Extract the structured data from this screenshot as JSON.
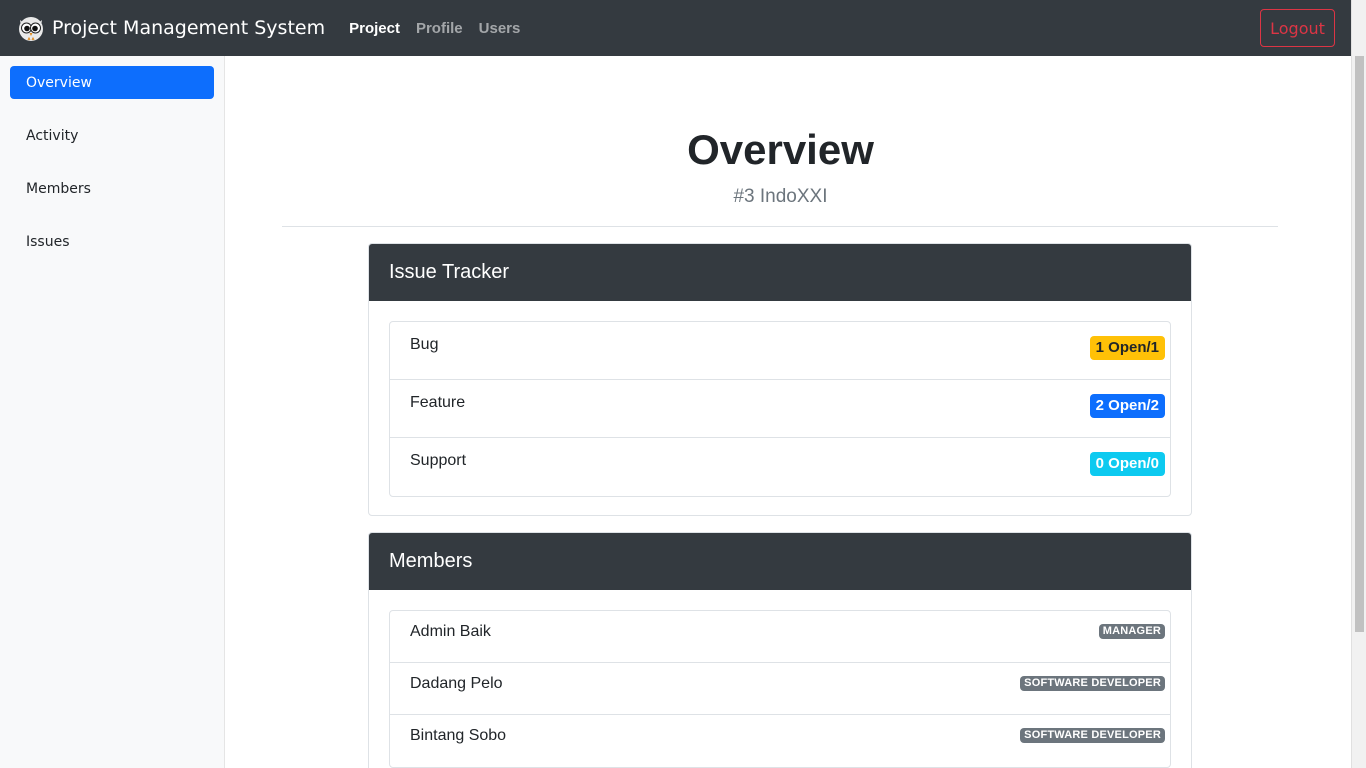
{
  "navbar": {
    "brand": "Project Management System",
    "links": [
      {
        "label": "Project",
        "active": true
      },
      {
        "label": "Profile",
        "active": false
      },
      {
        "label": "Users",
        "active": false
      }
    ],
    "logout_label": "Logout"
  },
  "sidebar": {
    "items": [
      {
        "label": "Overview",
        "active": true
      },
      {
        "label": "Activity",
        "active": false
      },
      {
        "label": "Members",
        "active": false
      },
      {
        "label": "Issues",
        "active": false
      }
    ]
  },
  "main": {
    "title": "Overview",
    "subtitle": "#3 IndoXXI",
    "issue_tracker": {
      "header": "Issue Tracker",
      "rows": [
        {
          "name": "Bug",
          "badge": "1 Open/1",
          "badge_color": "#ffc107",
          "badge_text_color": "#212529"
        },
        {
          "name": "Feature",
          "badge": "2 Open/2",
          "badge_color": "#0d6efd",
          "badge_text_color": "#ffffff"
        },
        {
          "name": "Support",
          "badge": "0 Open/0",
          "badge_color": "#0dcaf0",
          "badge_text_color": "#ffffff"
        }
      ]
    },
    "members": {
      "header": "Members",
      "rows": [
        {
          "name": "Admin Baik",
          "role": "MANAGER"
        },
        {
          "name": "Dadang Pelo",
          "role": "SOFTWARE DEVELOPER"
        },
        {
          "name": "Bintang Sobo",
          "role": "SOFTWARE DEVELOPER"
        }
      ]
    }
  },
  "colors": {
    "navbar_bg": "#343a40",
    "accent": "#0d6efd",
    "danger": "#dc3545",
    "secondary": "#6c757d"
  },
  "icons": {
    "brand_logo": "owl-logo-icon"
  }
}
